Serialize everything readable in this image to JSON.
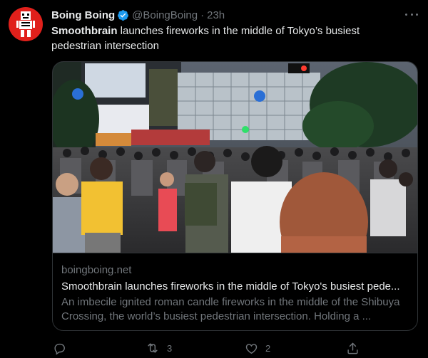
{
  "tweet": {
    "author_name": "Boing Boing",
    "author_handle": "@BoingBoing",
    "separator": "·",
    "time": "23h",
    "text_bold": "Smoothbrain",
    "text_rest": " launches fireworks in the middle of Tokyo’s busiest pedestrian intersection"
  },
  "card": {
    "domain": "boingboing.net",
    "title": "Smoothbrain launches fireworks in the middle of Tokyo's busiest pede...",
    "description": "An imbecile ignited roman candle fireworks in the middle of the Shibuya Crossing, the world’s busiest pedestrian intersection. Holding a ..."
  },
  "actions": {
    "reply_count": "",
    "retweet_count": "3",
    "like_count": "2",
    "share_count": ""
  },
  "colors": {
    "background": "#000000",
    "text_primary": "#e7e9ea",
    "text_secondary": "#71767b",
    "verified": "#1d9bf0",
    "avatar_red": "#e0201b",
    "border": "#2f3336"
  },
  "icons": {
    "verified": "verified-badge-icon",
    "more": "more-dots-icon",
    "reply": "reply-icon",
    "retweet": "retweet-icon",
    "like": "heart-icon",
    "share": "share-icon"
  }
}
